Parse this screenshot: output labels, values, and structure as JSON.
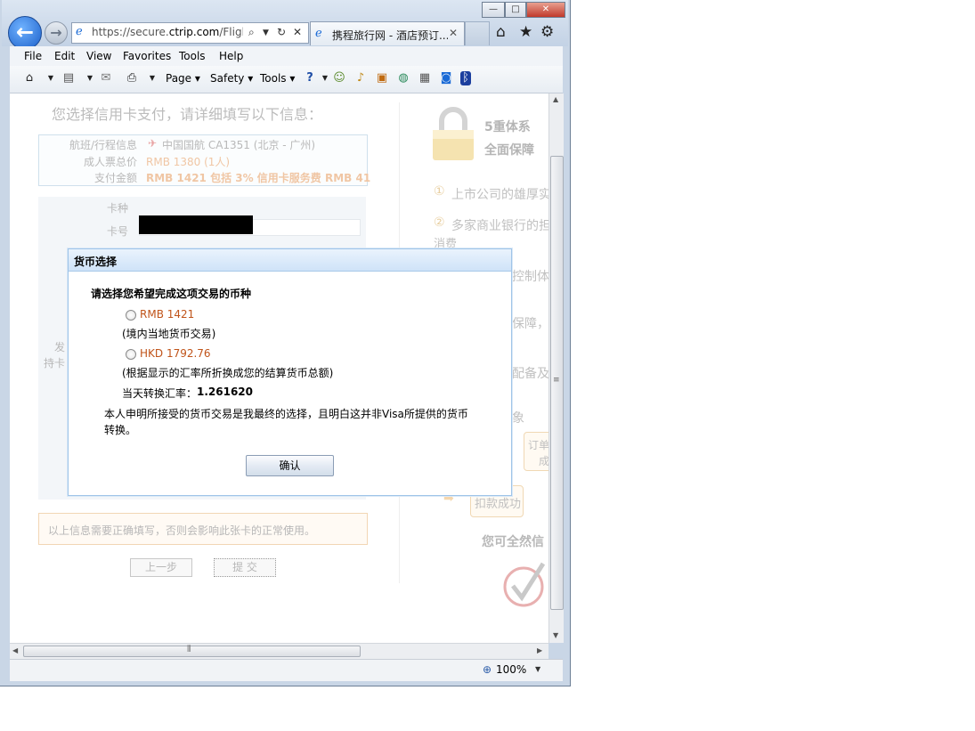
{
  "browser": {
    "address_url": "https://secure.ctrip.com/FlightP",
    "address_url_host": "ctrip.com",
    "tab_title": "携程旅行网 - 酒店预订...",
    "menu": [
      "File",
      "Edit",
      "View",
      "Favorites",
      "Tools",
      "Help"
    ],
    "command_bar": {
      "page": "Page",
      "safety": "Safety",
      "tools": "Tools"
    },
    "zoom": "100%"
  },
  "page": {
    "heading": "您选择信用卡支付，请详细填写以下信息：",
    "flight": {
      "label_flight": "航班/行程信息",
      "flight_value": "中国国航 CA1351 (北京 - 广州)",
      "label_price": "成人票总价",
      "price_value": "RMB 1380 (1人)",
      "label_amount": "支付金额",
      "amount_value": "RMB   1421 包括 3%  信用卡服务费 RMB 41"
    },
    "card": {
      "label_type": "卡种",
      "label_number": "卡号",
      "label_issuer_fragment": "发",
      "label_holder_fragment": "持卡"
    },
    "notice": "以上信息需要正确填写，否则会影响此张卡的正常使用。",
    "prev_button": "上一步",
    "submit_button": "提  交",
    "right": {
      "title_line1": "5重体系",
      "title_line2": "全面保障",
      "item1_num": "①",
      "item1": "上市公司的雄厚实",
      "item2_num": "②",
      "item2": "多家商业银行的担",
      "item2_cont": "消费",
      "fragment_control": "控制体",
      "fragment_guarantee": "保障，",
      "fragment_equip": "配备及",
      "fragment_xiang": "象",
      "order_line1": "订单",
      "order_line2": "成",
      "deduct": "扣款成功",
      "assure": "您可全然信"
    }
  },
  "modal": {
    "title": "货币选择",
    "prompt": "请选择您希望完成这项交易的币种",
    "option1": "RMB 1421",
    "option1_note": "(境内当地货币交易)",
    "option2": "HKD 1792.76",
    "option2_note": "(根据显示的汇率所折换成您的结算货币总额)",
    "rate_label": "当天转换汇率：",
    "rate_value": "1.261620",
    "declaration_line1": "本人申明所接受的货币交易是我最终的选择，且明白这并非Visa所提供的货币",
    "declaration_line2": "转换。",
    "confirm": "确认"
  },
  "colors": {
    "option_text": "#c0541a",
    "modal_title_bg": "#d7e8fa",
    "ie_blue": "#1b5fc9"
  }
}
